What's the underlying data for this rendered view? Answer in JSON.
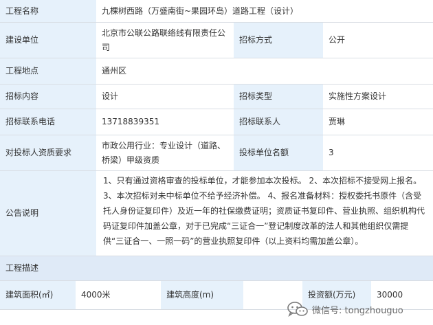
{
  "rows": {
    "project_name": {
      "label": "工程名称",
      "value": "九棵树西路（万盛南街~果园环岛）道路工程（设计）"
    },
    "builder": {
      "label": "建设单位",
      "value": "北京市公联公路联络线有限责任公司",
      "method_label": "招标方式",
      "method_value": "公开"
    },
    "location": {
      "label": "工程地点",
      "value": "通州区"
    },
    "content": {
      "label": "招标内容",
      "value": "设计",
      "type_label": "招标类型",
      "type_value": "实施性方案设计"
    },
    "contact": {
      "label": "招标联系电话",
      "value": "13718839351",
      "person_label": "招标联系人",
      "person_value": "贾琳"
    },
    "qualification": {
      "label": "对投标人资质要求",
      "value": "市政公用行业：专业设计（道路、桥梁）甲级资质",
      "quota_label": "投标单位名额",
      "quota_value": "3"
    },
    "notice": {
      "label": "公告说明",
      "text": "1、只有通过资格审查的投标单位，才能参加本次投标。 2、本次招标不接受网上报名。 3、本次招标对未中标单位不给予经济补偿。 4、报名准备材料：授权委托书原件（含受托人身份证复印件）及近一年的社保缴费证明；资质证书复印件、营业执照、组织机构代码证复印件加盖公章，对于已完成“三证合一”登记制度改革的法人和其他组织仅需提供“三证合一、一照一码”的营业执照复印件（以上资料均需加盖公章）。"
    }
  },
  "section": {
    "title": "工程描述"
  },
  "desc": {
    "area_label": "建筑面积(㎡)",
    "area_value": "4000米",
    "height_label": "建筑高度(m)",
    "investment_label": "投资额(万元)",
    "investment_value": "30000"
  },
  "watermark": {
    "text": "微信号: tongzhouguo",
    "icon": "wechat-icon"
  }
}
